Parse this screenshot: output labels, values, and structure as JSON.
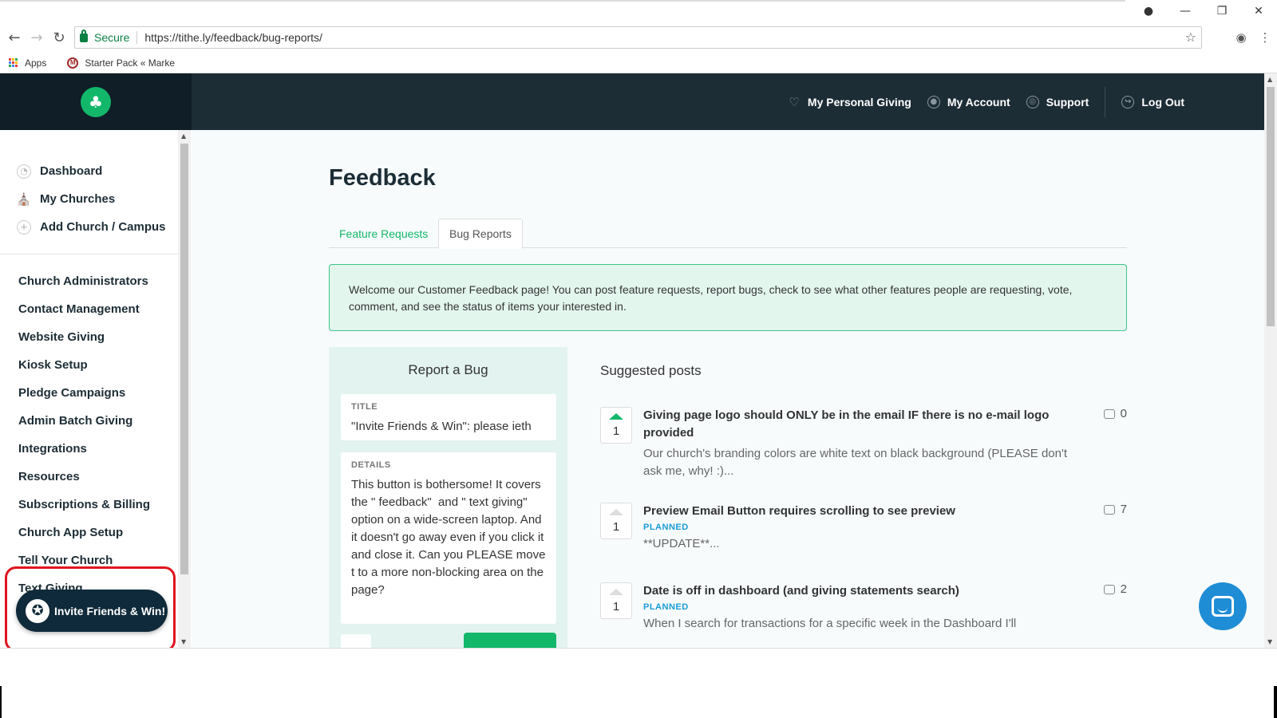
{
  "browser": {
    "secure_label": "Secure",
    "url": "https://tithe.ly/feedback/bug-reports/",
    "bookmarks": [
      {
        "label": "Apps",
        "icon": "apps-grid-icon"
      },
      {
        "label": "Starter Pack « Marke",
        "icon": "m-favicon-icon"
      }
    ]
  },
  "header": {
    "nav": [
      {
        "label": "My Personal Giving",
        "icon": "heart-icon"
      },
      {
        "label": "My Account",
        "icon": "user-circle-icon"
      },
      {
        "label": "Support",
        "icon": "lifebuoy-icon"
      },
      {
        "label": "Log Out",
        "icon": "logout-icon"
      }
    ]
  },
  "sidebar": {
    "top_items": [
      {
        "label": "Dashboard",
        "icon": "dashboard-icon"
      },
      {
        "label": "My Churches",
        "icon": "church-icon"
      },
      {
        "label": "Add Church / Campus",
        "icon": "plus-circle-icon"
      }
    ],
    "items": [
      {
        "label": "Church Administrators"
      },
      {
        "label": "Contact Management"
      },
      {
        "label": "Website Giving"
      },
      {
        "label": "Kiosk Setup"
      },
      {
        "label": "Pledge Campaigns"
      },
      {
        "label": "Admin Batch Giving"
      },
      {
        "label": "Integrations"
      },
      {
        "label": "Resources"
      },
      {
        "label": "Subscriptions & Billing"
      },
      {
        "label": "Church App Setup"
      },
      {
        "label": "Tell Your Church"
      },
      {
        "label": "Text Giving"
      }
    ]
  },
  "invite": {
    "label": "Invite Friends & Win!"
  },
  "main": {
    "title": "Feedback",
    "tabs": [
      {
        "label": "Feature Requests",
        "active": false
      },
      {
        "label": "Bug Reports",
        "active": true
      }
    ],
    "welcome": "Welcome our Customer Feedback page! You can post feature requests, report bugs, check to see what other features people are requesting, vote, comment, and see the status of items your interested in.",
    "report": {
      "heading": "Report a Bug",
      "title_label": "TITLE",
      "title_value": "\"Invite Friends & Win\": please ieth",
      "details_label": "DETAILS",
      "details_value": "This button is bothersome! It covers the \" feedback\"  and \" text giving\" option on a wide-screen laptop. And it doesn't go away even if you click it and close it. Can you PLEASE move t to a more non-blocking area on the page?"
    },
    "suggested": {
      "heading": "Suggested posts",
      "posts": [
        {
          "votes": "1",
          "voted": true,
          "title": "Giving page logo should ONLY be in the email IF there is no e-mail logo provided",
          "status": "",
          "excerpt": "Our church's branding colors are white text on black background (PLEASE don't ask me, why! :)...",
          "comments": "0"
        },
        {
          "votes": "1",
          "voted": false,
          "title": "Preview Email Button requires scrolling to see preview",
          "status": "PLANNED",
          "excerpt": "**UPDATE**...",
          "comments": "7"
        },
        {
          "votes": "1",
          "voted": false,
          "title": "Date is off in dashboard (and giving statements search)",
          "status": "PLANNED",
          "excerpt": "When I search for transactions for a specific week in the Dashboard I'll",
          "comments": "2"
        }
      ]
    }
  },
  "colors": {
    "brand_green": "#12b76a",
    "header_dark": "#1d2d36",
    "status_blue": "#1a9bd8",
    "highlight_red": "#e0141e"
  }
}
